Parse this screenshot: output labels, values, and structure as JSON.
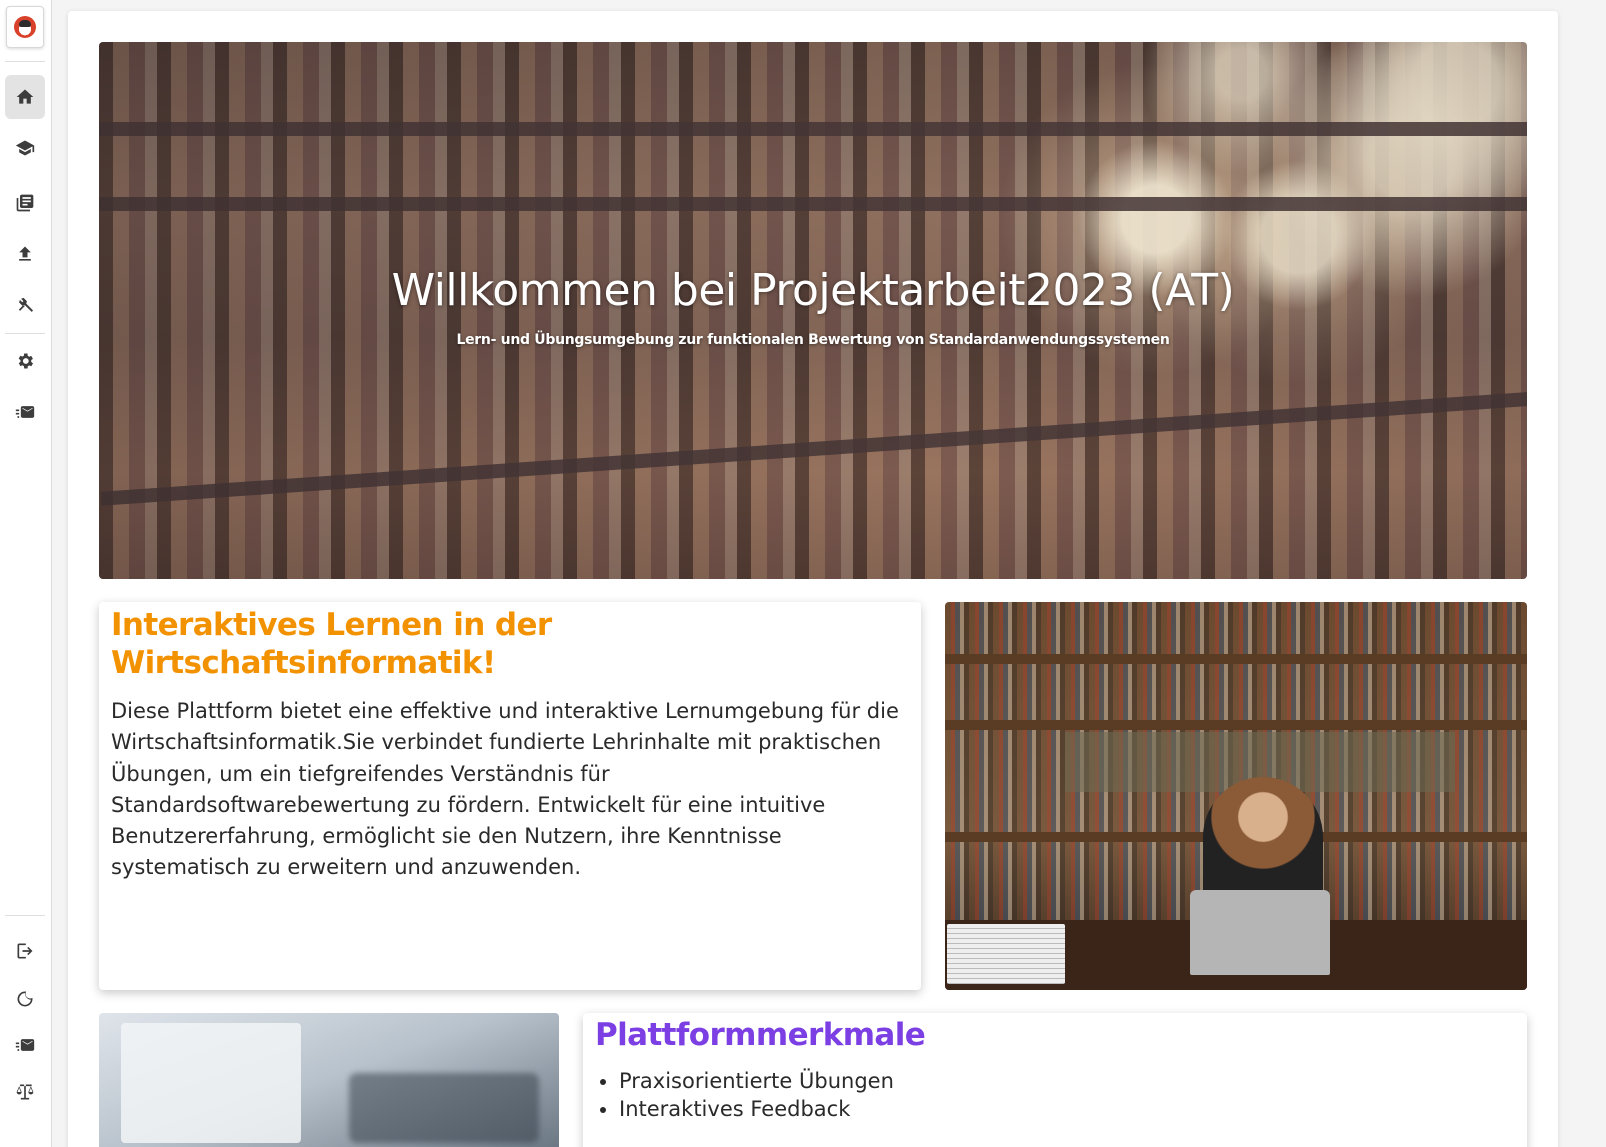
{
  "sidebar": {
    "logo_icon": "bird-mascot-icon",
    "top_items": [
      {
        "name": "home",
        "icon": "home-icon",
        "active": true
      },
      {
        "name": "courses",
        "icon": "graduation-cap-icon",
        "active": false
      },
      {
        "name": "library",
        "icon": "book-stack-icon",
        "active": false
      },
      {
        "name": "upload",
        "icon": "upload-icon",
        "active": false
      },
      {
        "name": "tools",
        "icon": "tools-icon",
        "active": false
      },
      {
        "name": "settings",
        "icon": "gear-icon",
        "active": false
      },
      {
        "name": "messages",
        "icon": "mail-icon",
        "active": false
      }
    ],
    "bottom_items": [
      {
        "name": "logout",
        "icon": "logout-icon"
      },
      {
        "name": "dark-mode",
        "icon": "moon-icon"
      },
      {
        "name": "contact",
        "icon": "mail-icon"
      },
      {
        "name": "legal",
        "icon": "scales-icon"
      }
    ]
  },
  "hero": {
    "title": "Willkommen bei Projektarbeit2023 (AT)",
    "subtitle": "Lern- und Übungsumgebung zur funktionalen Bewertung von Standardanwendungssystemen"
  },
  "intro": {
    "title": "Interaktives Lernen in der Wirtschaftsinformatik!",
    "text": "Diese Plattform bietet eine effektive und interaktive Lernumgebung für die Wirtschaftsinformatik.Sie verbindet fundierte Lehrinhalte mit praktischen Übungen, um ein tiefgreifendes Verständnis für Standardsoftwarebewertung zu fördern. Entwickelt für eine intuitive Benutzererfahrung, ermöglicht sie den Nutzern, ihre Kenntnisse systematisch zu erweitern und anzuwenden."
  },
  "features": {
    "title": "Plattformmerkmale",
    "items": [
      "Praxisorientierte Übungen",
      "Interaktives Feedback"
    ]
  },
  "colors": {
    "intro_title": "#f39200",
    "features_title": "#7b3fe4"
  }
}
